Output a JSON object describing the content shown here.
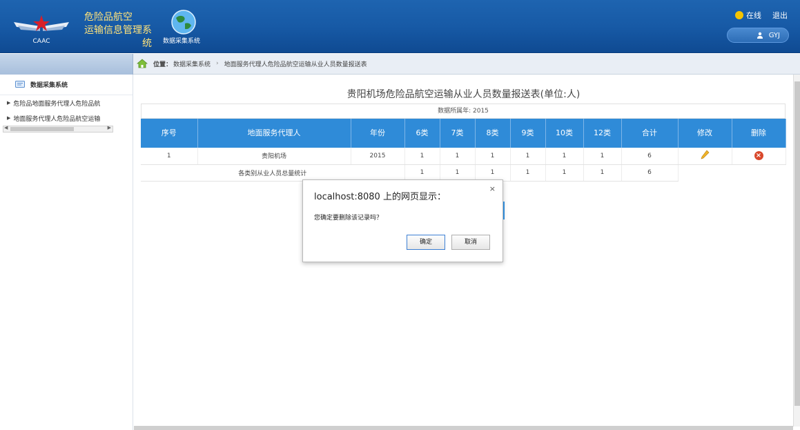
{
  "header": {
    "logo_text": "CAAC",
    "app_name_line1": "危险品航空",
    "app_name_line2": "运输信息管理系统",
    "module_label": "数据采集系统",
    "online_label": "在线",
    "logout_label": "退出",
    "username": "GYJ"
  },
  "breadcrumb": {
    "prefix": "位置：",
    "level1": "数据采集系统",
    "separator": "›",
    "level2": "地面服务代理人危险品航空运输从业人员数量报送表"
  },
  "sidebar": {
    "title": "数据采集系统",
    "items": [
      {
        "label": "危险品地面服务代理人危险品航"
      },
      {
        "label": "地面服务代理人危险品航空运输"
      }
    ]
  },
  "main": {
    "title": "贵阳机场危险品航空运输从业人员数量报送表(单位:人)",
    "data_year": "数据所属年: 2015",
    "columns": [
      "序号",
      "地面服务代理人",
      "年份",
      "6类",
      "7类",
      "8类",
      "9类",
      "10类",
      "12类",
      "合计",
      "修改",
      "删除"
    ],
    "rows": [
      {
        "index": "1",
        "agent": "贵阳机场",
        "year": "2015",
        "c6": "1",
        "c7": "1",
        "c8": "1",
        "c9": "1",
        "c10": "1",
        "c12": "1",
        "total": "6"
      }
    ],
    "summary": {
      "label": "各类别从业人员总量统计",
      "c6": "1",
      "c7": "1",
      "c8": "1",
      "c9": "1",
      "c10": "1",
      "c12": "1",
      "total": "6"
    }
  },
  "dialog": {
    "title": "localhost:8080 上的网页显示：",
    "close": "×",
    "message": "您确定要删除该记录吗？",
    "ok_label": "确定",
    "cancel_label": "取消"
  },
  "colors": {
    "header_bg": "#175aa6",
    "table_header": "#2f8bd8",
    "delete_red": "#d9482b"
  }
}
